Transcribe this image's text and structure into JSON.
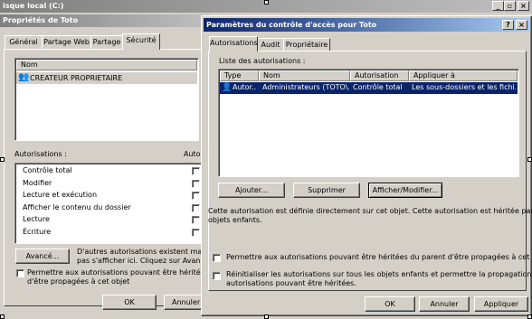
{
  "top_bar": {
    "title": "isque local (C:)"
  },
  "props_window": {
    "title": "Propriétés de Toto",
    "tabs": [
      {
        "label": "Général"
      },
      {
        "label": "Partage Web"
      },
      {
        "label": "Partage"
      },
      {
        "label": "Sécurité"
      }
    ],
    "names_header": "Nom",
    "names": [
      {
        "label": "CREATEUR PROPRIETAIRE"
      }
    ],
    "perm_label": "Autorisations :",
    "perm_col": "Autor",
    "permissions": [
      {
        "label": "Contrôle total"
      },
      {
        "label": "Modifier"
      },
      {
        "label": "Lecture et exécution"
      },
      {
        "label": "Afficher le contenu du dossier"
      },
      {
        "label": "Lecture"
      },
      {
        "label": "Écriture"
      }
    ],
    "advanced_button": "Avancé...",
    "info_line1": "D'autres autorisations existent mais ne",
    "info_line2": "pas s'afficher ici. Cliquez sur Avancé p",
    "inherit_line1": "Permettre aux autorisations pouvant être héritées du p",
    "inherit_line2": "d'être propagées à cet objet",
    "ok_button": "OK",
    "cancel_button": "Annuler"
  },
  "acl_dialog": {
    "title": "Paramètres du contrôle d'accès pour Toto",
    "help_btn": "?",
    "close_btn": "×",
    "tabs": [
      {
        "label": "Autorisations"
      },
      {
        "label": "Audit"
      },
      {
        "label": "Propriétaire"
      }
    ],
    "list_label": "Liste des autorisations :",
    "columns": {
      "type": "Type",
      "name": "Nom",
      "permission": "Autorisation",
      "applies": "Appliquer à"
    },
    "rows": [
      {
        "type": "Autor...",
        "name": "Administrateurs (TOTO\\...",
        "permission": "Contrôle total",
        "applies": "Les sous-dossiers et les fichi..."
      }
    ],
    "add_button": "Ajouter...",
    "remove_button": "Supprimer",
    "view_button": "Afficher/Modifier...",
    "desc_line1": "Cette autorisation est définie directement sur cet objet. Cette autorisation est héritée par les",
    "desc_line2": "objets enfants.",
    "check1": "Permettre aux autorisations pouvant être héritées du parent d'être propagées à cet objet",
    "check2_line1": "Réinitialiser les autorisations sur tous les objets enfants et permettre la propagation des",
    "check2_line2": "autorisations pouvant être héritées.",
    "ok_button": "OK",
    "cancel_button": "Annuler",
    "apply_button": "Appliquer"
  },
  "colors": {
    "title_active_start": "#0a246a",
    "title_active_end": "#a6caf0",
    "title_inactive_start": "#808080",
    "title_inactive_end": "#c0c0c0",
    "selection": "#0a246a",
    "face": "#d4d0c8"
  }
}
